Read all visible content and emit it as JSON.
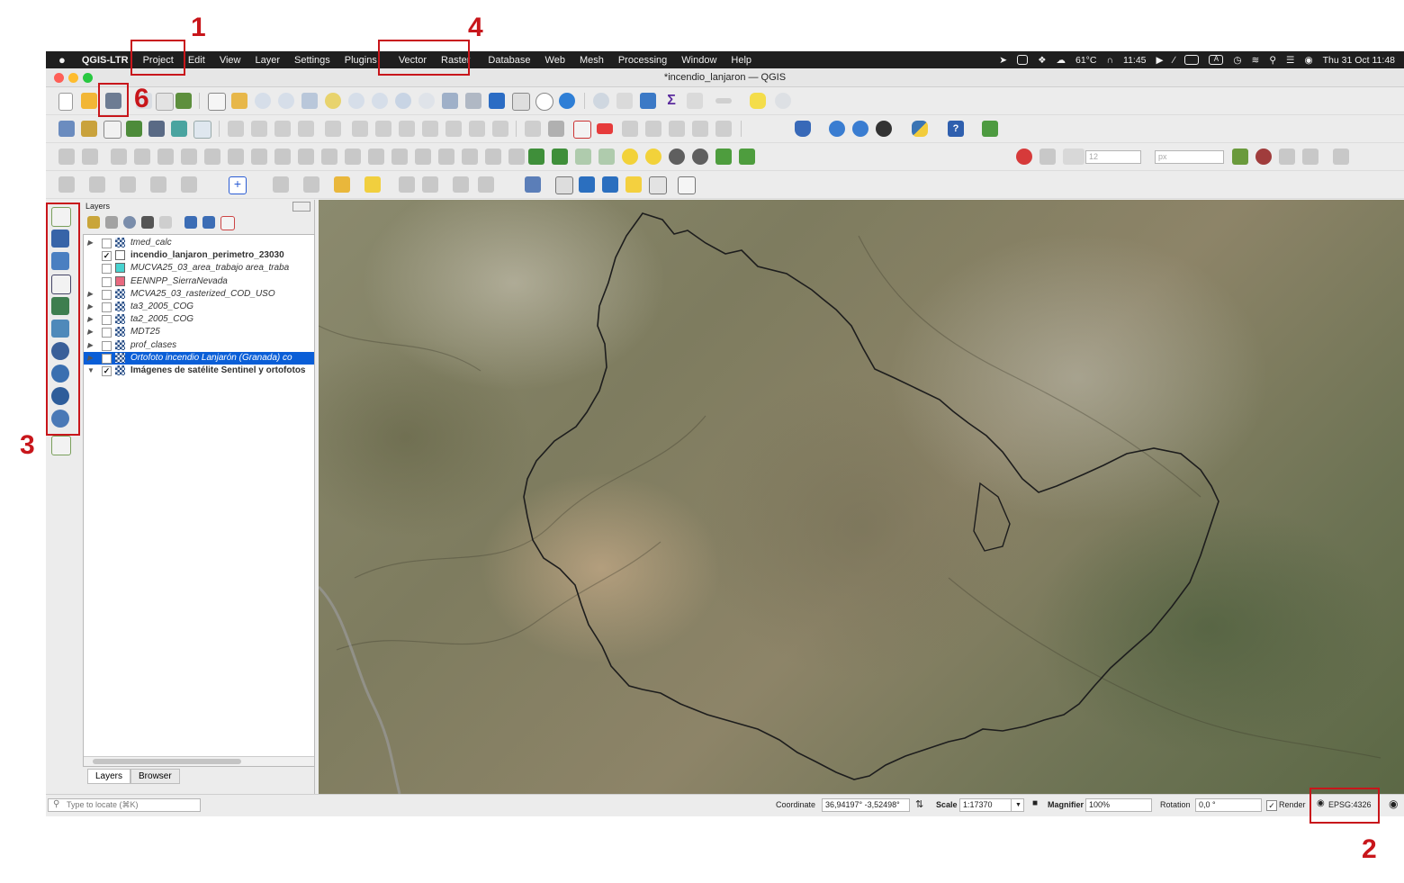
{
  "annotations": {
    "n1": "1",
    "n2": "2",
    "n3": "3",
    "n4": "4",
    "n6": "6"
  },
  "mac_menubar": {
    "apple": "",
    "app": "QGIS-LTR",
    "items": [
      "Project",
      "Edit",
      "View",
      "Layer",
      "Settings",
      "Plugins",
      "Vector",
      "Raster",
      "Database",
      "Web",
      "Mesh",
      "Processing",
      "Window",
      "Help"
    ],
    "status_right": {
      "temp": "61°C",
      "timer": "11:45",
      "clock": "Thu 31 Oct  11:48",
      "keyboard": "A"
    }
  },
  "window": {
    "title": "*incendio_lanjaron — QGIS"
  },
  "toolbar": {
    "snap_value": "12",
    "snap_unit": "px"
  },
  "layers_panel": {
    "title": "Layers",
    "rows": [
      {
        "name": "tmed_calc",
        "checked": false,
        "style": "italic",
        "swatch": "raster"
      },
      {
        "name": "incendio_lanjaron_perimetro_23030",
        "checked": true,
        "style": "bold",
        "swatch": "white"
      },
      {
        "name": "MUCVA25_03_area_trabajo area_traba",
        "checked": false,
        "style": "italic",
        "swatch": "#48d3d0"
      },
      {
        "name": "EENNPP_SierraNevada",
        "checked": false,
        "style": "italic",
        "swatch": "#e8697f"
      },
      {
        "name": "MCVA25_03_rasterized_COD_USO",
        "checked": false,
        "style": "italic",
        "swatch": "raster"
      },
      {
        "name": "ta3_2005_COG",
        "checked": false,
        "style": "italic",
        "swatch": "raster"
      },
      {
        "name": "ta2_2005_COG",
        "checked": false,
        "style": "italic",
        "swatch": "raster"
      },
      {
        "name": "MDT25",
        "checked": false,
        "style": "italic",
        "swatch": "raster"
      },
      {
        "name": "prof_clases",
        "checked": false,
        "style": "italic",
        "swatch": "raster"
      },
      {
        "name": "Ortofoto incendio Lanjarón (Granada) co",
        "checked": false,
        "style": "italic-selected",
        "swatch": "wms"
      },
      {
        "name": "Imágenes de satélite Sentinel y ortofotos",
        "checked": true,
        "style": "bold",
        "swatch": "raster"
      }
    ],
    "tabs": [
      "Layers",
      "Browser"
    ]
  },
  "statusbar": {
    "locator_placeholder": "Type to locate (⌘K)",
    "coordinate_label": "Coordinate",
    "coordinate_value": "36,94197° -3,52498°",
    "scale_label": "Scale",
    "scale_value": "1:17370",
    "magnifier_label": "Magnifier",
    "magnifier_value": "100%",
    "rotation_label": "Rotation",
    "rotation_value": "0,0 °",
    "render_label": "Render",
    "crs": "EPSG:4326"
  }
}
